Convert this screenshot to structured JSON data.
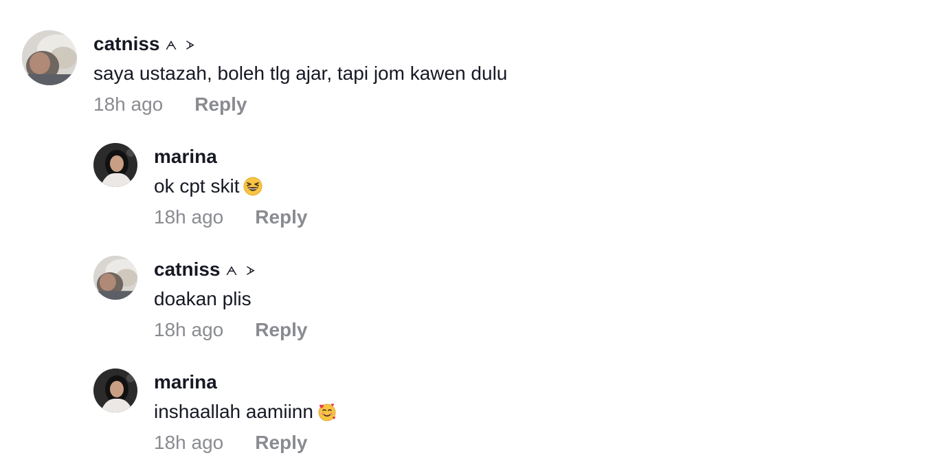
{
  "comments": [
    {
      "username": "catniss",
      "username_decoration": "ᗅ ᗆ",
      "text": "saya ustazah, boleh tlg ajar, tapi jom kawen dulu",
      "emoji": "",
      "time": "18h ago",
      "reply_label": "Reply",
      "avatar": "catniss-avatar"
    },
    {
      "username": "marina",
      "username_decoration": "",
      "text": "ok cpt skit",
      "emoji": "grinning-squinting-face-icon",
      "time": "18h ago",
      "reply_label": "Reply",
      "avatar": "marina-avatar"
    },
    {
      "username": "catniss",
      "username_decoration": "ᗅ ᗆ",
      "text": "doakan plis",
      "emoji": "",
      "time": "18h ago",
      "reply_label": "Reply",
      "avatar": "catniss-avatar"
    },
    {
      "username": "marina",
      "username_decoration": "",
      "text": "inshaallah aamiinn",
      "emoji": "smiling-face-with-hearts-icon",
      "time": "18h ago",
      "reply_label": "Reply",
      "avatar": "marina-avatar"
    }
  ],
  "colors": {
    "text_primary": "#161823",
    "text_secondary": "#8a8b91",
    "background": "#ffffff"
  }
}
